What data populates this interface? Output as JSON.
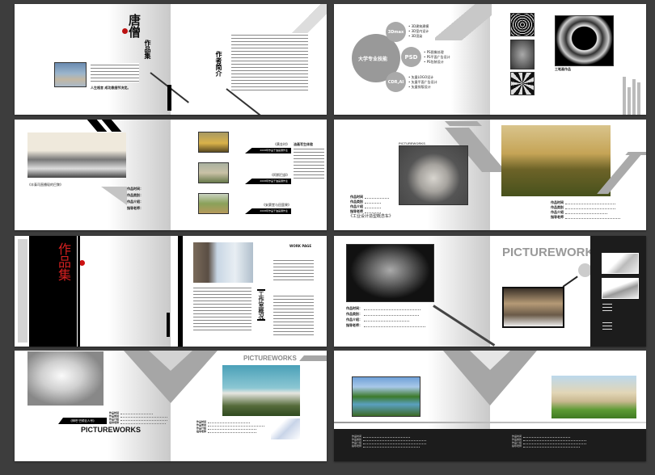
{
  "spread1": {
    "title_calligraphy": "唐僧",
    "title": "作品集",
    "about_title": "作者简介",
    "portrait_caption": "人生格言 成功靠细节决定。"
  },
  "spread2": {
    "main_circle": "大学专业技能",
    "skills": [
      {
        "name": "3Dmax",
        "items": [
          "• 3D建筑建模",
          "• 3D室内设计",
          "• 3D渲染"
        ]
      },
      {
        "name": "PSD",
        "items": [
          "• PS图像处理",
          "• PS平面广告设计",
          "• PS包装设计"
        ]
      },
      {
        "name": "CDR,AI",
        "items": [
          "• 矢量LOGO设计",
          "• 矢量平面广告设计",
          "• 矢量排版设计"
        ]
      }
    ],
    "featured_caption": "工笔画作品"
  },
  "spread3": {
    "sketch_caption": "《丰泰司直播现的巴黎》",
    "fields": [
      "作品时间：",
      "作品类别：",
      "作品介绍：",
      "指导老师："
    ],
    "paintings": [
      {
        "title": "《黄金时》",
        "sub": "2008年作品于油画课作业"
      },
      {
        "title": "《阿斯巴部》",
        "sub": "2008年作品于油画课作业"
      },
      {
        "title": "《安赛堂与田蛮果》",
        "sub": "2008年作品于油画课作业"
      }
    ],
    "essay_title": "油画写生体验"
  },
  "spread4": {
    "header": "PICTUREWORKS",
    "caption": "《工业设计造型概念车》",
    "fields": [
      "作品时间",
      "作品类别",
      "作品介绍",
      "指导老师"
    ]
  },
  "spread5": {
    "cover_title": "作品集",
    "studio_title": "工作室概况",
    "right_heading": "WORK PAGE"
  },
  "spread6": {
    "header": "PICTUREWORKS",
    "fields": [
      "作品时间：",
      "作品类别：",
      "作品介绍：",
      "指导老师："
    ]
  },
  "spread7": {
    "caption": "《神吧\"巴顿巨人号》",
    "brand": "PICTUREWORKS",
    "header": "PICTUREWORKS",
    "fields": [
      "作品时间",
      "作品类别",
      "作品介绍",
      "指导老师"
    ]
  },
  "spread8": {
    "fields": [
      "作品时间",
      "作品类别",
      "作品介绍",
      "指导老师"
    ]
  }
}
